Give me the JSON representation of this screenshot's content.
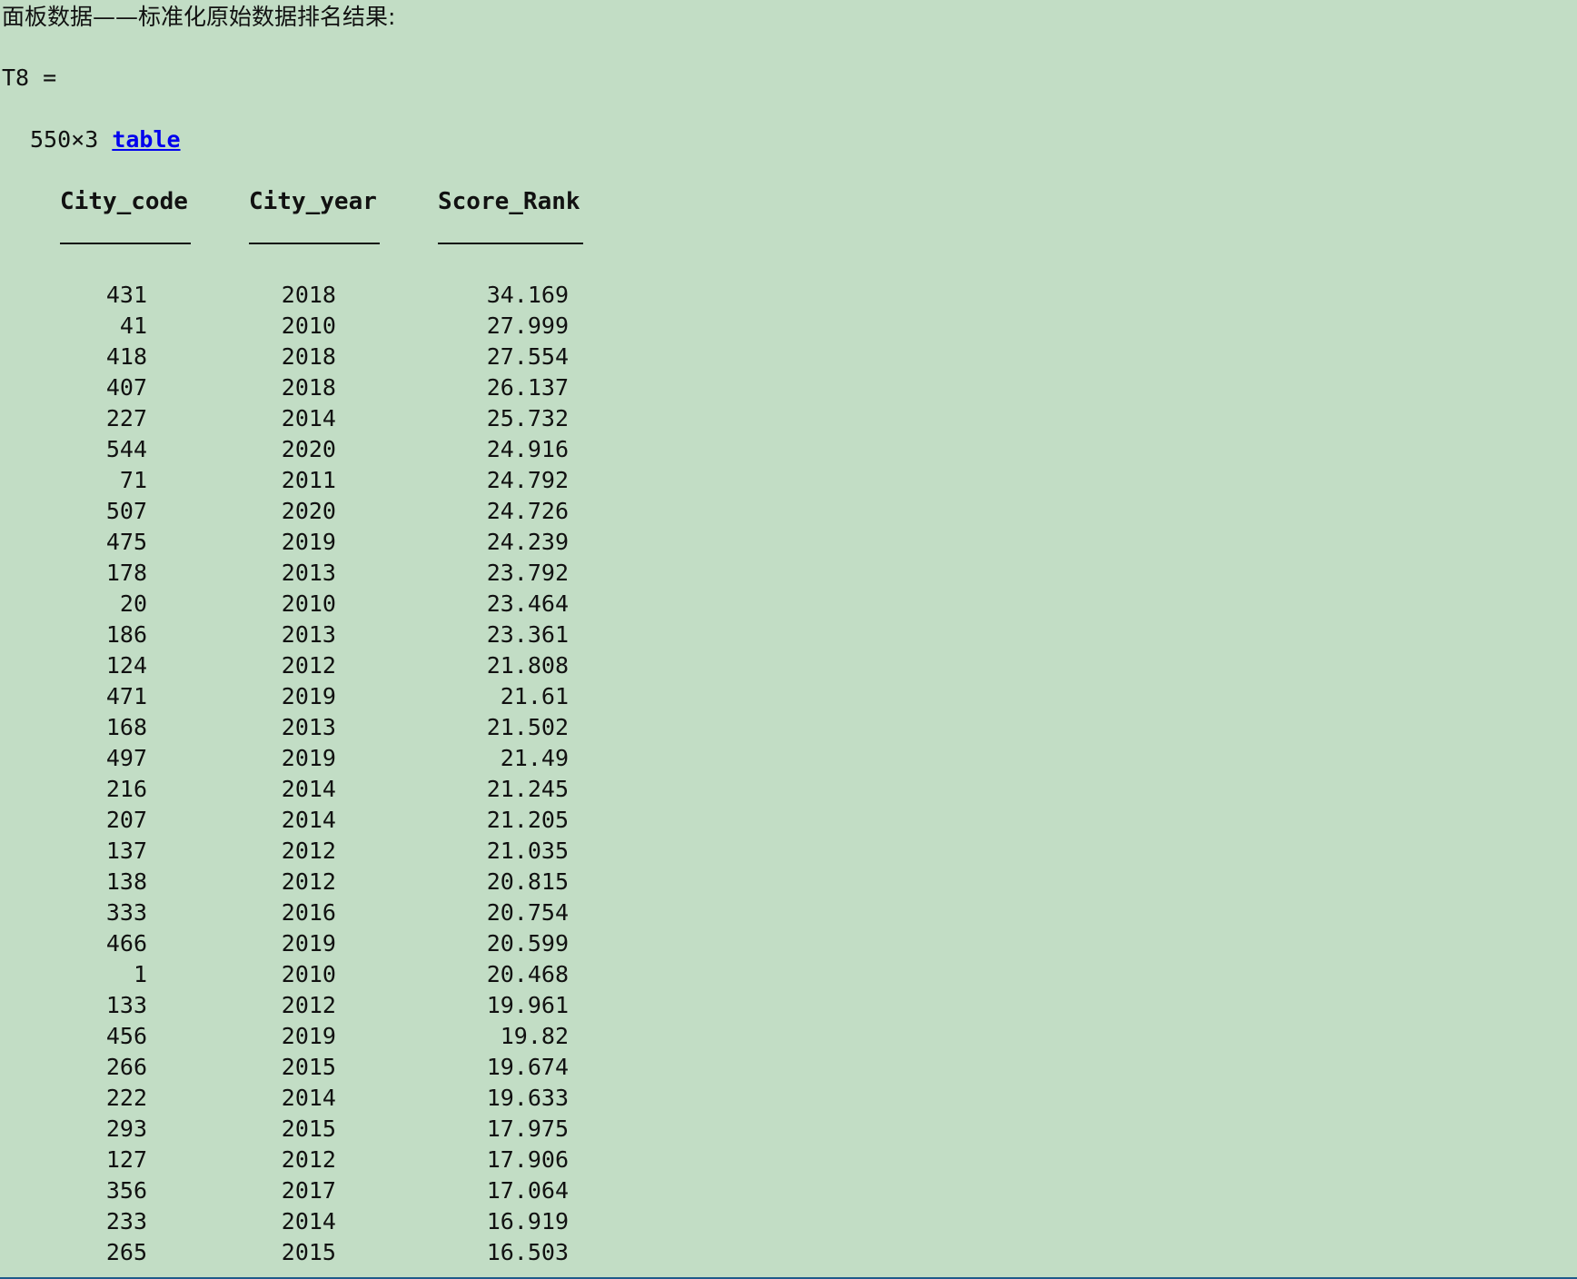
{
  "output": {
    "heading": "面板数据——标准化原始数据排名结果:",
    "variable_line": "T8 =",
    "size_text": "550×3 ",
    "size_link": "table"
  },
  "table": {
    "columns": [
      "City_code",
      "City_year",
      "Score_Rank"
    ],
    "rows": [
      [
        "431",
        "2018",
        "34.169"
      ],
      [
        "41",
        "2010",
        "27.999"
      ],
      [
        "418",
        "2018",
        "27.554"
      ],
      [
        "407",
        "2018",
        "26.137"
      ],
      [
        "227",
        "2014",
        "25.732"
      ],
      [
        "544",
        "2020",
        "24.916"
      ],
      [
        "71",
        "2011",
        "24.792"
      ],
      [
        "507",
        "2020",
        "24.726"
      ],
      [
        "475",
        "2019",
        "24.239"
      ],
      [
        "178",
        "2013",
        "23.792"
      ],
      [
        "20",
        "2010",
        "23.464"
      ],
      [
        "186",
        "2013",
        "23.361"
      ],
      [
        "124",
        "2012",
        "21.808"
      ],
      [
        "471",
        "2019",
        "21.61"
      ],
      [
        "168",
        "2013",
        "21.502"
      ],
      [
        "497",
        "2019",
        "21.49"
      ],
      [
        "216",
        "2014",
        "21.245"
      ],
      [
        "207",
        "2014",
        "21.205"
      ],
      [
        "137",
        "2012",
        "21.035"
      ],
      [
        "138",
        "2012",
        "20.815"
      ],
      [
        "333",
        "2016",
        "20.754"
      ],
      [
        "466",
        "2019",
        "20.599"
      ],
      [
        "1",
        "2010",
        "20.468"
      ],
      [
        "133",
        "2012",
        "19.961"
      ],
      [
        "456",
        "2019",
        "19.82"
      ],
      [
        "266",
        "2015",
        "19.674"
      ],
      [
        "222",
        "2014",
        "19.633"
      ],
      [
        "293",
        "2015",
        "17.975"
      ],
      [
        "127",
        "2012",
        "17.906"
      ],
      [
        "356",
        "2017",
        "17.064"
      ],
      [
        "233",
        "2014",
        "16.919"
      ],
      [
        "265",
        "2015",
        "16.503"
      ]
    ]
  }
}
